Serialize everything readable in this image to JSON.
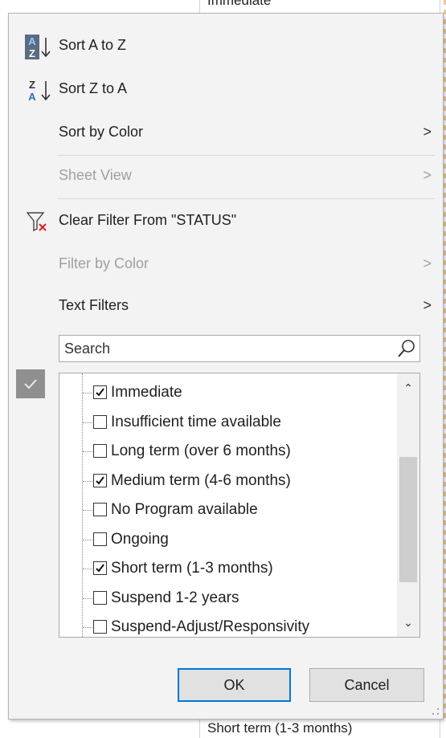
{
  "background": {
    "cell_above": "Immediate",
    "cell_below": "Short term (1-3 months)"
  },
  "menu": {
    "sort_az": "Sort A to Z",
    "sort_za": "Sort Z to A",
    "sort_by_color": "Sort by Color",
    "sheet_view": "Sheet View",
    "clear_filter": "Clear Filter From \"STATUS\"",
    "filter_by_color": "Filter by Color",
    "text_filters": "Text Filters",
    "chevron": ">"
  },
  "search": {
    "placeholder": "Search"
  },
  "list": {
    "items": [
      {
        "label": "Immediate",
        "checked": true
      },
      {
        "label": "Insufficient time available",
        "checked": false
      },
      {
        "label": "Long term (over 6 months)",
        "checked": false
      },
      {
        "label": "Medium term (4-6 months)",
        "checked": true
      },
      {
        "label": "No Program available",
        "checked": false
      },
      {
        "label": "Ongoing",
        "checked": false
      },
      {
        "label": "Short term (1-3 months)",
        "checked": true
      },
      {
        "label": "Suspend 1-2 years",
        "checked": false
      },
      {
        "label": "Suspend-Adjust/Responsivity",
        "checked": false
      }
    ]
  },
  "buttons": {
    "ok": "OK",
    "cancel": "Cancel"
  },
  "colors": {
    "accent": "#0078d7",
    "clear_filter_x": "#e02020",
    "sort_icon_blue": "#2b6cc4"
  }
}
